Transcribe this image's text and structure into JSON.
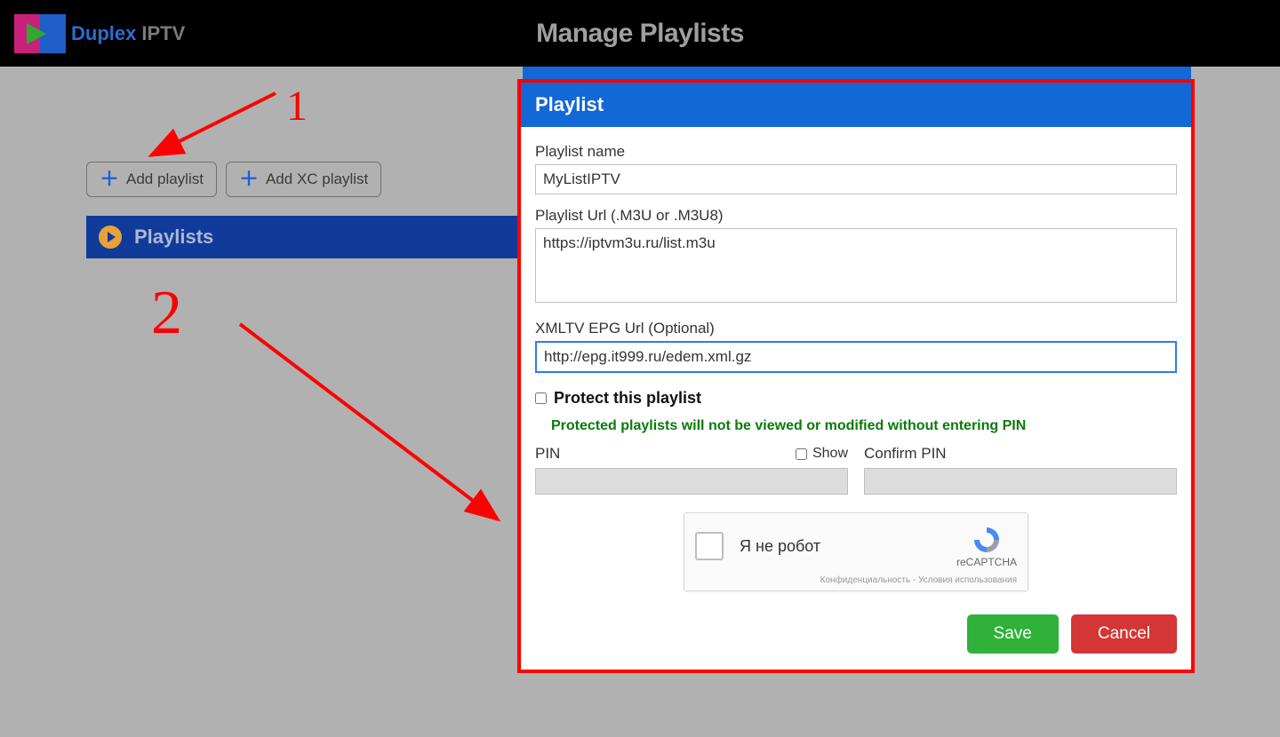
{
  "header": {
    "logo_text1": "Duplex",
    "logo_text2": "IPTV",
    "title": "Manage Playlists"
  },
  "toolbar": {
    "add_playlist_label": "Add playlist",
    "add_xc_playlist_label": "Add XC playlist"
  },
  "sidebar": {
    "playlists_label": "Playlists"
  },
  "annotation": {
    "num1": "1",
    "num2": "2"
  },
  "modal": {
    "title": "Playlist",
    "fields": {
      "name_label": "Playlist name",
      "name_value": "MyListIPTV",
      "url_label": "Playlist Url (.M3U or .M3U8)",
      "url_value": "https://iptvm3u.ru/list.m3u",
      "epg_label": "XMLTV EPG Url (Optional)",
      "epg_value": "http://epg.it999.ru/edem.xml.gz",
      "protect_label": "Protect this playlist",
      "protect_note": "Protected playlists will not be viewed or modified without entering PIN",
      "pin_label": "PIN",
      "show_label": "Show",
      "confirm_pin_label": "Confirm PIN"
    },
    "captcha": {
      "label": "Я не робот",
      "brand": "reCAPTCHA",
      "footer": "Конфиденциальность - Условия использования"
    },
    "buttons": {
      "save": "Save",
      "cancel": "Cancel"
    }
  }
}
